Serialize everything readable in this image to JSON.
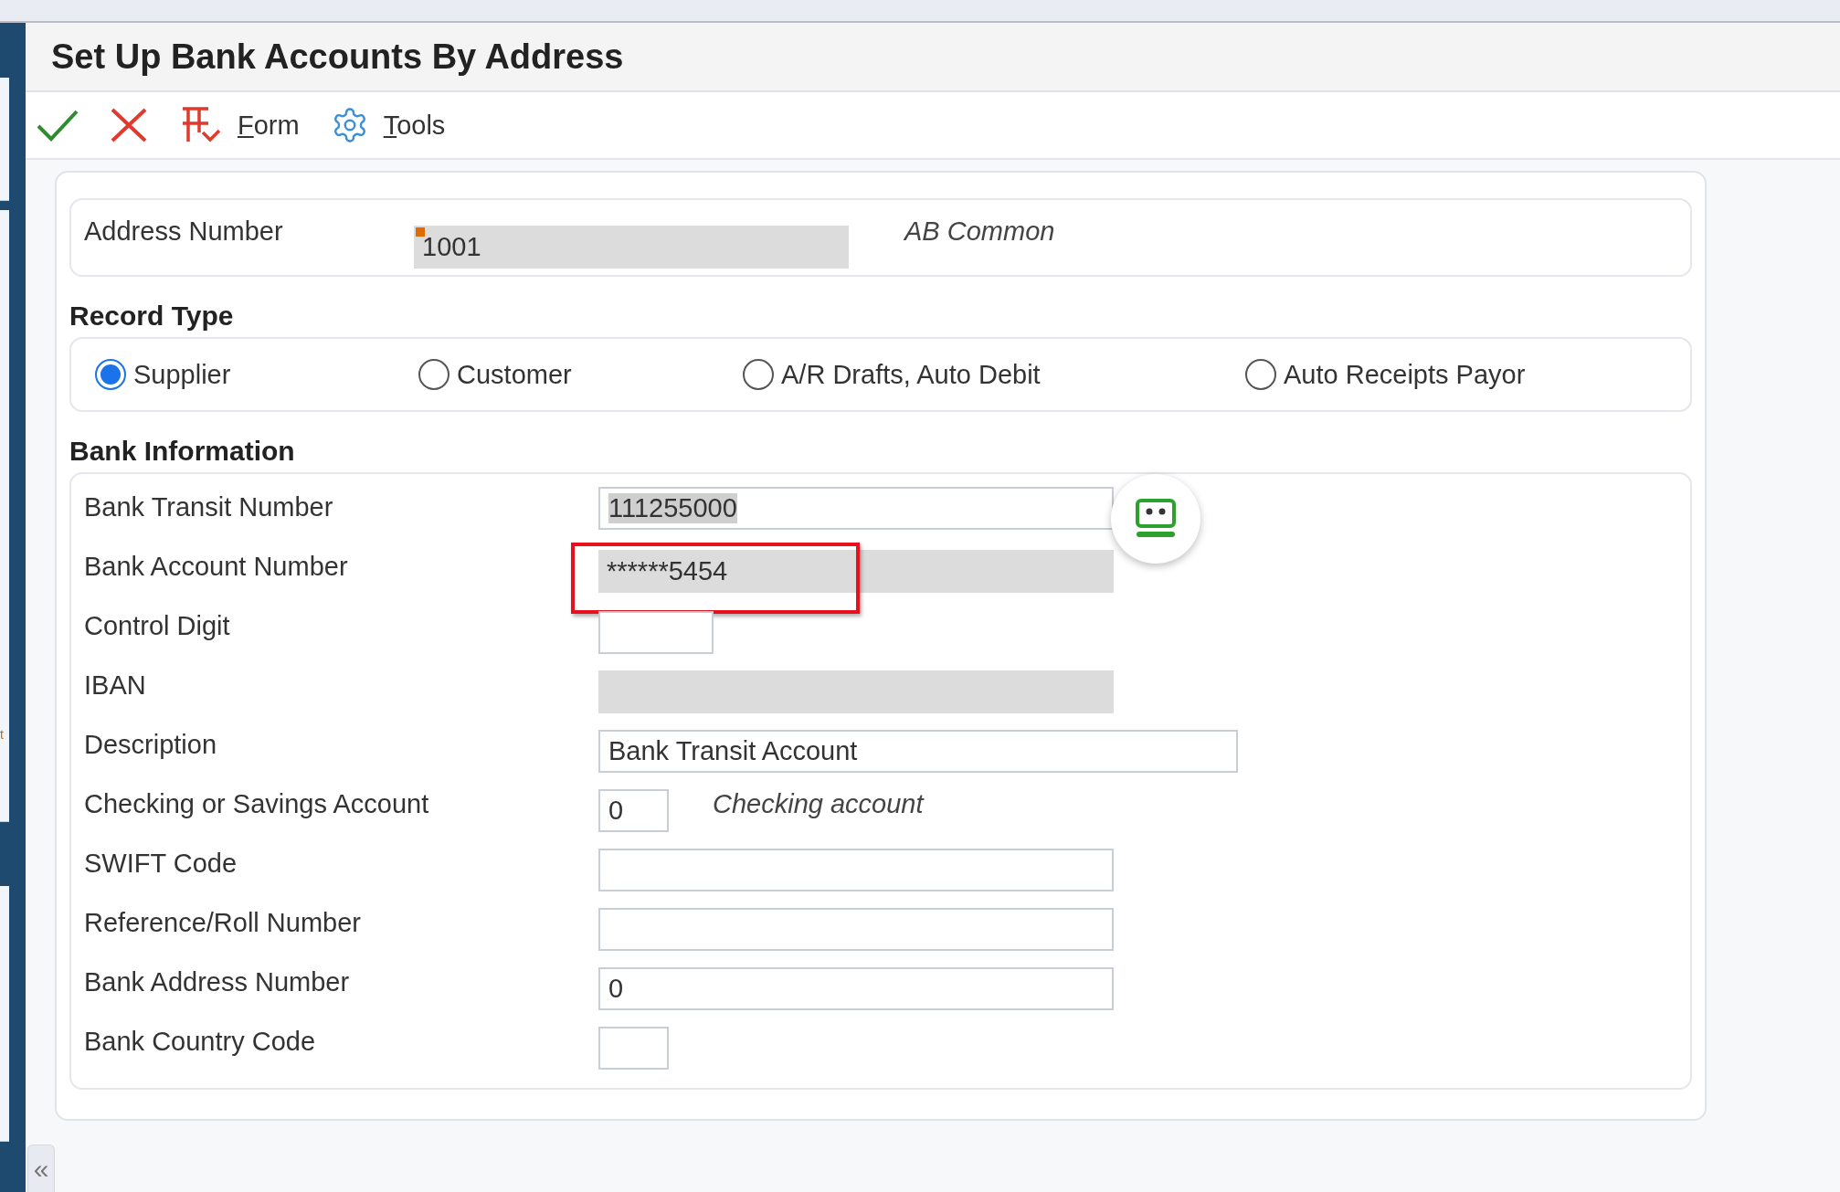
{
  "window": {
    "title": "Set Up Bank Accounts By Address"
  },
  "left_pane": {
    "text": "t"
  },
  "toolbar": [
    {
      "kind": "ok"
    },
    {
      "kind": "cancel"
    },
    {
      "kind": "form",
      "label": "Form"
    },
    {
      "kind": "tools",
      "label": "Tools"
    }
  ],
  "address": {
    "label": "Address Number",
    "value": "1001",
    "required": true,
    "description": "AB Common"
  },
  "record_type": {
    "heading": "Record Type",
    "options": [
      {
        "label": "Supplier",
        "selected": true
      },
      {
        "label": "Customer",
        "selected": false
      },
      {
        "label": "A/R Drafts, Auto Debit",
        "selected": false
      },
      {
        "label": "Auto Receipts Payor",
        "selected": false
      }
    ]
  },
  "bank_information": {
    "heading": "Bank Information",
    "fields": [
      {
        "label": "Bank Transit Number",
        "value": "111255000",
        "disabled": false,
        "text_selected": true
      },
      {
        "label": "Bank Account Number",
        "value": "******5454",
        "disabled": true,
        "highlighted": true
      },
      {
        "label": "Control Digit",
        "disabled": false
      },
      {
        "label": "IBAN",
        "disabled": true
      },
      {
        "label": "Description",
        "value": "Bank Transit Account",
        "disabled": false
      },
      {
        "label": "Checking or Savings Account",
        "value": "0",
        "hint": "Checking account",
        "disabled": false
      },
      {
        "label": "SWIFT Code",
        "disabled": false
      },
      {
        "label": "Reference/Roll Number",
        "disabled": false
      },
      {
        "label": "Bank Address Number",
        "value": "0",
        "disabled": false
      },
      {
        "label": "Bank Country Code",
        "disabled": false
      }
    ]
  },
  "collapse": {
    "label": "«"
  }
}
